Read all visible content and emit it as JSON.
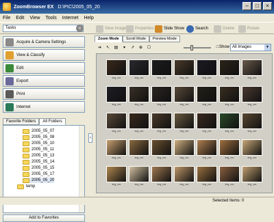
{
  "window": {
    "app_name": "ZoomBrowser EX",
    "path": "D:\\PIC\\2005_05_20"
  },
  "menu": [
    "File",
    "Edit",
    "View",
    "Tools",
    "Internet",
    "Help"
  ],
  "toolbar": {
    "tasks_label": "Tasks",
    "buttons": [
      {
        "label": "View Image",
        "enabled": false
      },
      {
        "label": "Properties",
        "enabled": false
      },
      {
        "label": "Slide Show",
        "enabled": true
      },
      {
        "label": "Search",
        "enabled": true
      },
      {
        "label": "Delete",
        "enabled": false
      },
      {
        "label": "Rotate",
        "enabled": false
      }
    ]
  },
  "tasks": [
    {
      "label": "Acquire & Camera Settings",
      "color": "#8a8a8a"
    },
    {
      "label": "View & Classify",
      "color": "#e0a030"
    },
    {
      "label": "Edit",
      "color": "#3a8a3a"
    },
    {
      "label": "Export",
      "color": "#6a6a9a"
    },
    {
      "label": "Print",
      "color": "#5a5a5a"
    },
    {
      "label": "Internet",
      "color": "#2a7a5a"
    }
  ],
  "folders": {
    "tabs": [
      "Favorite Folders",
      "All Folders"
    ],
    "active_tab": "All Folders",
    "items": [
      "2005_05_07",
      "2005_05_08",
      "2005_05_10",
      "2005_05_11",
      "2005_05_13",
      "2005_05_14",
      "2005_05_15",
      "2005_05_17",
      "2005_05_20",
      "temp"
    ],
    "add_button": "Add to Favorites"
  },
  "view_modes": {
    "tabs": [
      "Zoom Mode",
      "Scroll Mode",
      "Preview Mode"
    ],
    "active": "Zoom Mode"
  },
  "display": {
    "show_label": "Show",
    "filter": "All Images"
  },
  "thumbnails": {
    "rows": [
      [
        "#3b2a1c",
        "#2a2a30",
        "#1c1c1c",
        "#4a3a2a",
        "#1a1a22",
        "#2c2418",
        "#6a5a4a"
      ],
      [
        "#1e1e24",
        "#3a3026",
        "#2a2620",
        "#5a4a3a",
        "#222018",
        "#3a2e20",
        "#4a3a30"
      ],
      [
        "#5a4a38",
        "#3a2a1e",
        "#4a3a2a",
        "#6a5a40",
        "#3a2a20",
        "#2a4a2a",
        "#5a4830"
      ],
      [
        "#c9a070",
        "#8a6a40",
        "#6a5030",
        "#d0b080",
        "#b08050",
        "#a07040",
        "#c8a878"
      ],
      [
        "#b08850",
        "#d2c0a0",
        "#a07850",
        "#c09868",
        "#9a7040",
        "#8a6040",
        "#c0a070"
      ]
    ],
    "caption": "img_xxx"
  },
  "status": {
    "selected": "Selected Items: 0"
  }
}
